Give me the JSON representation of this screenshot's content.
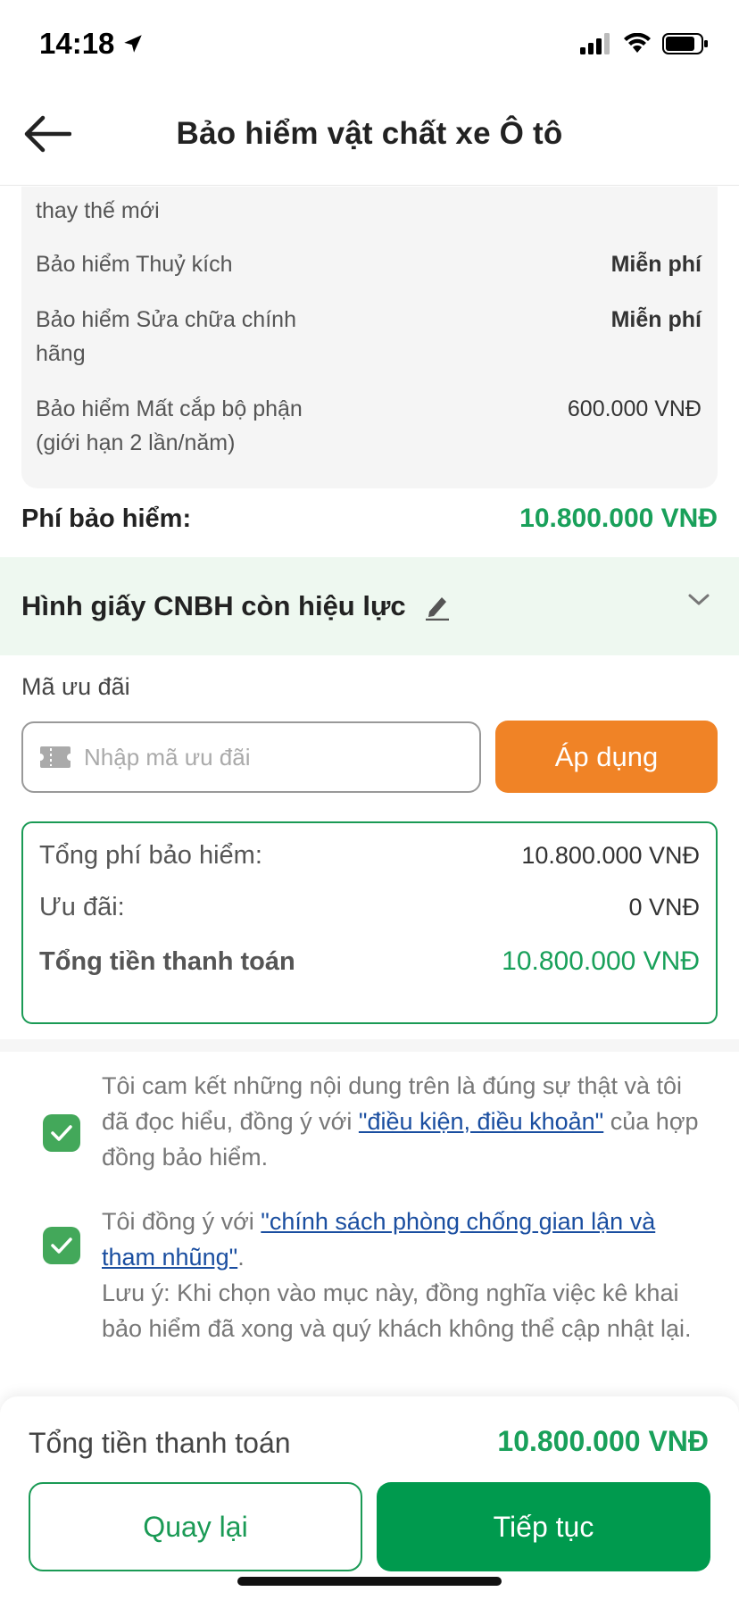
{
  "status_bar": {
    "time": "14:18"
  },
  "header": {
    "title": "Bảo hiểm vật chất xe Ô tô"
  },
  "coverage": {
    "items": [
      {
        "label": "thay thế mới",
        "value": ""
      },
      {
        "label": "Bảo hiểm Thuỷ kích",
        "value": "Miễn phí"
      },
      {
        "label": "Bảo hiểm Sửa chữa chính hãng",
        "value": "Miễn phí"
      },
      {
        "label": "Bảo hiểm Mất cắp bộ phận (giới hạn 2 lần/năm)",
        "value": "600.000 VNĐ"
      }
    ]
  },
  "fee": {
    "label": "Phí bảo hiểm:",
    "value": "10.800.000 VNĐ"
  },
  "certificate": {
    "title": "Hình giấy CNBH còn hiệu lực"
  },
  "promo": {
    "label": "Mã ưu đãi",
    "placeholder": "Nhập mã ưu đãi",
    "apply_label": "Áp dụng"
  },
  "summary": {
    "total_fee_label": "Tổng phí bảo hiểm:",
    "total_fee_value": "10.800.000 VNĐ",
    "discount_label": "Ưu đãi:",
    "discount_value": "0 VNĐ",
    "total_payment_label": "Tổng tiền thanh toán",
    "total_payment_value": "10.800.000 VNĐ"
  },
  "agreements": {
    "first": {
      "text_before": "Tôi cam kết những nội dung trên là đúng sự thật và tôi đã đọc hiểu, đồng ý với ",
      "link": "\"điều kiện, điều khoản\"",
      "text_after": " của hợp đồng bảo hiểm.",
      "checked": true
    },
    "second": {
      "text_before": "Tôi đồng ý với ",
      "link": "\"chính sách phòng chống gian lận và tham nhũng\"",
      "text_after": ".",
      "note": "Lưu ý: Khi chọn vào mục này, đồng nghĩa việc kê khai bảo hiểm đã xong và quý khách không thể cập nhật lại.",
      "checked": true
    }
  },
  "bottom": {
    "total_label": "Tổng tiền thanh toán",
    "total_value": "10.800.000 VNĐ",
    "back_label": "Quay lại",
    "next_label": "Tiếp tục"
  },
  "colors": {
    "green": "#19a05a",
    "orange": "#f08326",
    "link": "#1a4ea0"
  }
}
